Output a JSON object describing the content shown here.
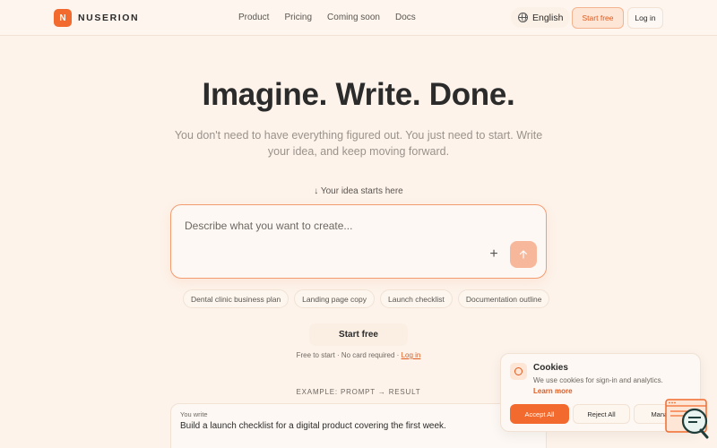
{
  "nav": {
    "logo_letter": "N",
    "brand": "NUSERION",
    "links": [
      "Product",
      "Pricing",
      "Coming soon",
      "Docs"
    ],
    "language": "English",
    "start_free": "Start free",
    "login": "Log in"
  },
  "hero": {
    "title": "Imagine. Write. Done.",
    "subtitle": "You don't need to have everything figured out. You just need to start. Write your idea, and keep moving forward.",
    "hint": "↓ Your idea starts here"
  },
  "prompt": {
    "placeholder": "Describe what you want to create...",
    "plus_icon": "plus-icon",
    "send_icon": "arrow-up-icon"
  },
  "chips": [
    "Dental clinic business plan",
    "Landing page copy",
    "Launch checklist",
    "Documentation outline"
  ],
  "cta": {
    "label": "Start free",
    "note_text": "Free to start · No card required · ",
    "note_link": "Log in"
  },
  "example": {
    "label": "EXAMPLE: PROMPT → RESULT",
    "you_write": "You write",
    "prompt_text": "Build a launch checklist for a digital product covering the first week."
  },
  "cookies": {
    "title": "Cookies",
    "text": "We use cookies for sign-in and analytics.",
    "learn_more": "Learn more",
    "accept": "Accept All",
    "reject": "Reject All",
    "manage": "Manage"
  },
  "colors": {
    "accent": "#f26a2e",
    "background": "#fdf3ea"
  }
}
